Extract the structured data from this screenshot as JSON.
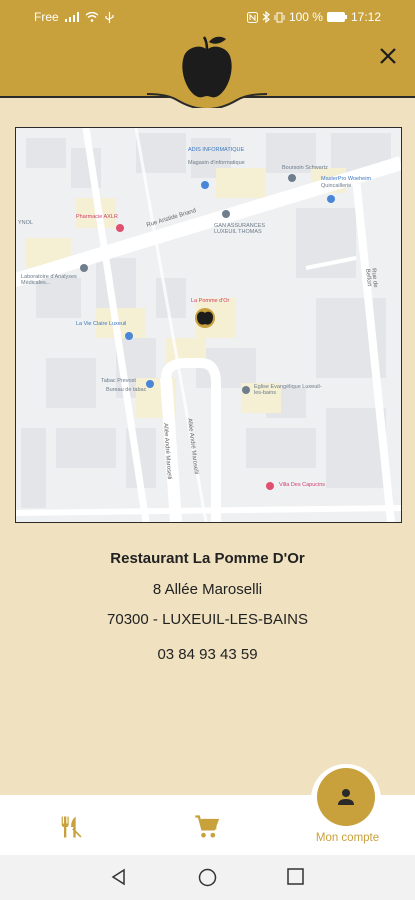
{
  "status_bar": {
    "carrier": "Free",
    "battery": "100 %",
    "time": "17:12"
  },
  "header": {
    "logo_icon": "apple-icon",
    "close_icon": "close-icon"
  },
  "map": {
    "pin_label": "La Pomme d'Or",
    "places": {
      "pharmacy": "Pharmacie AXLR",
      "adis": "ADIS INFORMATIQUE",
      "adis_sub": "Magasin d'informatique",
      "boursoin": "Boursoin Schwartz",
      "mastervolt": "MasterPro Woeheim",
      "mastervolt_sub": "Quincaillerie",
      "gan": "GAN ASSURANCES LUXEUIL THOMAS",
      "labo": "Laboratoire d'Analyses Médicales...",
      "vie_claire": "La Vie Claire Luxeuil",
      "tabac": "Tabac Prevost",
      "tabac_sub": "Bureau de tabac",
      "eglise": "Eglise Evangélique Luxeuil-les-bains",
      "villa": "Villa Des Capucins",
      "ynol": "YNOL"
    },
    "roads": {
      "aristide": "Rue Aristide Briand",
      "maroselli": "Allée André Maroselli",
      "maroselli2": "Allée André Maroselli",
      "belfort": "Rue de Belfort"
    }
  },
  "restaurant": {
    "name": "Restaurant La Pomme D'Or",
    "address_line1": "8 Allée Maroselli",
    "address_line2": "70300 - LUXEUIL-LES-BAINS",
    "phone": "03 84 93 43 59"
  },
  "bottom_nav": {
    "account_label": "Mon compte"
  },
  "colors": {
    "brand": "#c8a13d",
    "background": "#f0e2c1"
  }
}
